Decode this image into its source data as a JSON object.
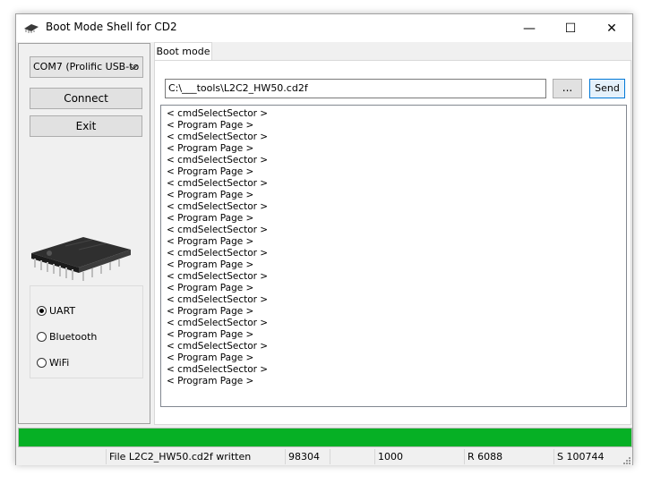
{
  "window": {
    "title": "Boot Mode Shell for CD2",
    "minimize_glyph": "—",
    "maximize_glyph": "☐",
    "close_glyph": "✕"
  },
  "left_panel": {
    "port_select": {
      "value": "COM7 (Prolific USB-to",
      "icon": "chevron-down-icon"
    },
    "connect_label": "Connect",
    "exit_label": "Exit",
    "chip_image": "microchip-icon",
    "mode_options": [
      {
        "label": "UART",
        "selected": true
      },
      {
        "label": "Bluetooth",
        "selected": false
      },
      {
        "label": "WiFi",
        "selected": false
      }
    ]
  },
  "tabs": [
    {
      "label": "Boot mode",
      "active": true
    }
  ],
  "boot_mode": {
    "file_path": "C:\\___tools\\L2C2_HW50.cd2f",
    "browse_label": "...",
    "send_label": "Send",
    "log_lines": [
      "< cmdSelectSector >",
      "< Program Page >",
      "< cmdSelectSector >",
      "< Program Page >",
      "< cmdSelectSector >",
      "< Program Page >",
      "< cmdSelectSector >",
      "< Program Page >",
      "< cmdSelectSector >",
      "< Program Page >",
      "< cmdSelectSector >",
      "< Program Page >",
      "< cmdSelectSector >",
      "< Program Page >",
      "< cmdSelectSector >",
      "< Program Page >",
      "< cmdSelectSector >",
      "< Program Page >",
      "< cmdSelectSector >",
      "< Program Page >",
      "< cmdSelectSector >",
      "< Program Page >",
      "< cmdSelectSector >",
      "< Program Page >"
    ]
  },
  "progress": {
    "fraction": 1.0,
    "color": "#06b025"
  },
  "status_bar": [
    {
      "text": ""
    },
    {
      "text": "File L2C2_HW50.cd2f written"
    },
    {
      "text": "98304"
    },
    {
      "text": ""
    },
    {
      "text": "1000"
    },
    {
      "text": "R 6088"
    },
    {
      "text": "S 100744"
    }
  ]
}
